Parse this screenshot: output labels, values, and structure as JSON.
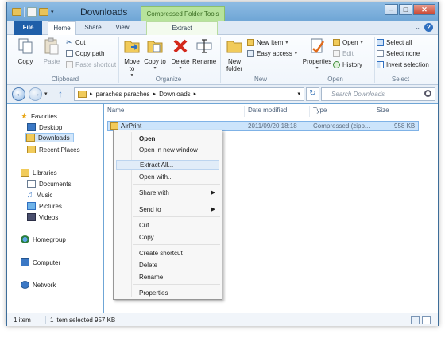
{
  "window": {
    "title": "Downloads",
    "context_tab_group": "Compressed Folder Tools"
  },
  "tabs": {
    "file": "File",
    "home": "Home",
    "share": "Share",
    "view": "View",
    "extract": "Extract"
  },
  "ribbon": {
    "clipboard": {
      "copy": "Copy",
      "paste": "Paste",
      "cut": "Cut",
      "copy_path": "Copy path",
      "paste_shortcut": "Paste shortcut",
      "label": "Clipboard"
    },
    "organize": {
      "move_to": "Move to",
      "copy_to": "Copy to",
      "delete": "Delete",
      "rename": "Rename",
      "label": "Organize"
    },
    "new": {
      "new_folder": "New folder",
      "new_item": "New item",
      "easy_access": "Easy access",
      "label": "New"
    },
    "open": {
      "properties": "Properties",
      "open": "Open",
      "edit": "Edit",
      "history": "History",
      "label": "Open"
    },
    "select": {
      "select_all": "Select all",
      "select_none": "Select none",
      "invert_selection": "Invert selection",
      "label": "Select"
    }
  },
  "address": {
    "crumbs": [
      "paraches paraches",
      "Downloads"
    ],
    "search_placeholder": "Search Downloads"
  },
  "nav_pane": {
    "favorites": "Favorites",
    "favorites_items": [
      "Desktop",
      "Downloads",
      "Recent Places"
    ],
    "libraries": "Libraries",
    "libraries_items": [
      "Documents",
      "Music",
      "Pictures",
      "Videos"
    ],
    "homegroup": "Homegroup",
    "computer": "Computer",
    "network": "Network"
  },
  "file_list": {
    "columns": [
      "Name",
      "Date modified",
      "Type",
      "Size"
    ],
    "rows": [
      {
        "name": "AirPrint",
        "date": "2011/09/20 18:18",
        "type": "Compressed (zipp...",
        "size": "958 KB"
      }
    ]
  },
  "context_menu": {
    "items": [
      "Open",
      "Open in new window",
      "Extract All...",
      "Open with...",
      "Share with",
      "Send to",
      "Cut",
      "Copy",
      "Create shortcut",
      "Delete",
      "Rename",
      "Properties"
    ]
  },
  "status": {
    "item_count": "1 item",
    "selection": "1 item selected  957 KB"
  },
  "colors": {
    "frame": "#6fa6d6",
    "file_tab": "#1f5fa9",
    "context_tab": "#b7e39c",
    "selection": "#cce4fb"
  }
}
